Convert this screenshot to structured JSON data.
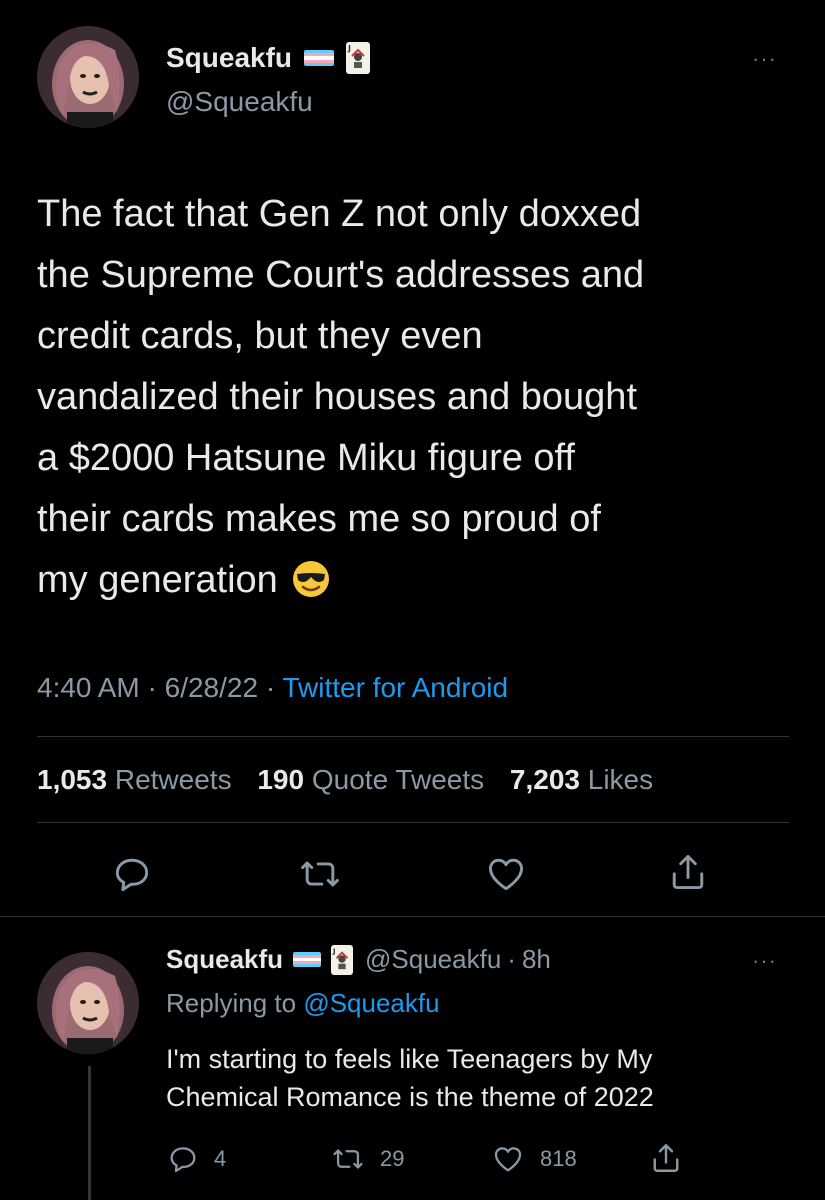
{
  "tweet": {
    "display_name": "Squeakfu",
    "handle": "@Squeakfu",
    "text_lines": [
      "The fact that Gen Z not only doxxed",
      "the Supreme Court's addresses and",
      "credit cards, but they even",
      "vandalized their houses and bought",
      "a $2000 Hatsune Miku figure off",
      "their cards makes me so proud of",
      "my generation"
    ],
    "time": "4:40 AM",
    "date": "6/28/22",
    "separator": "·",
    "source": "Twitter for Android",
    "stats": {
      "retweets_count": "1,053",
      "retweets_label": "Retweets",
      "quotes_count": "190",
      "quotes_label": "Quote Tweets",
      "likes_count": "7,203",
      "likes_label": "Likes"
    },
    "more_label": "···"
  },
  "reply": {
    "display_name": "Squeakfu",
    "handle": "@Squeakfu",
    "age": "8h",
    "separator": "·",
    "replying_prefix": "Replying to",
    "replying_handle": "@Squeakfu",
    "text_lines": [
      "I'm starting to feels like Teenagers by My",
      "Chemical Romance is the theme of 2022"
    ],
    "reply_count": "4",
    "retweet_count": "29",
    "like_count": "818",
    "more_label": "···"
  },
  "colors": {
    "background": "#000000",
    "text": "#e7e9ea",
    "muted": "#8b98a5",
    "link": "#1d9bf0",
    "divider": "#2f3336",
    "flag_blue": "#5bcefa",
    "flag_pink": "#f5a9b8",
    "flag_white": "#ffffff"
  },
  "icons": {
    "avatar": "avatar-image",
    "flag": "transgender-flag-icon",
    "card": "joker-card-icon",
    "emoji": "smiling-face-with-sunglasses-icon",
    "reply": "reply-icon",
    "retweet": "retweet-icon",
    "like": "heart-icon",
    "share": "share-icon"
  }
}
